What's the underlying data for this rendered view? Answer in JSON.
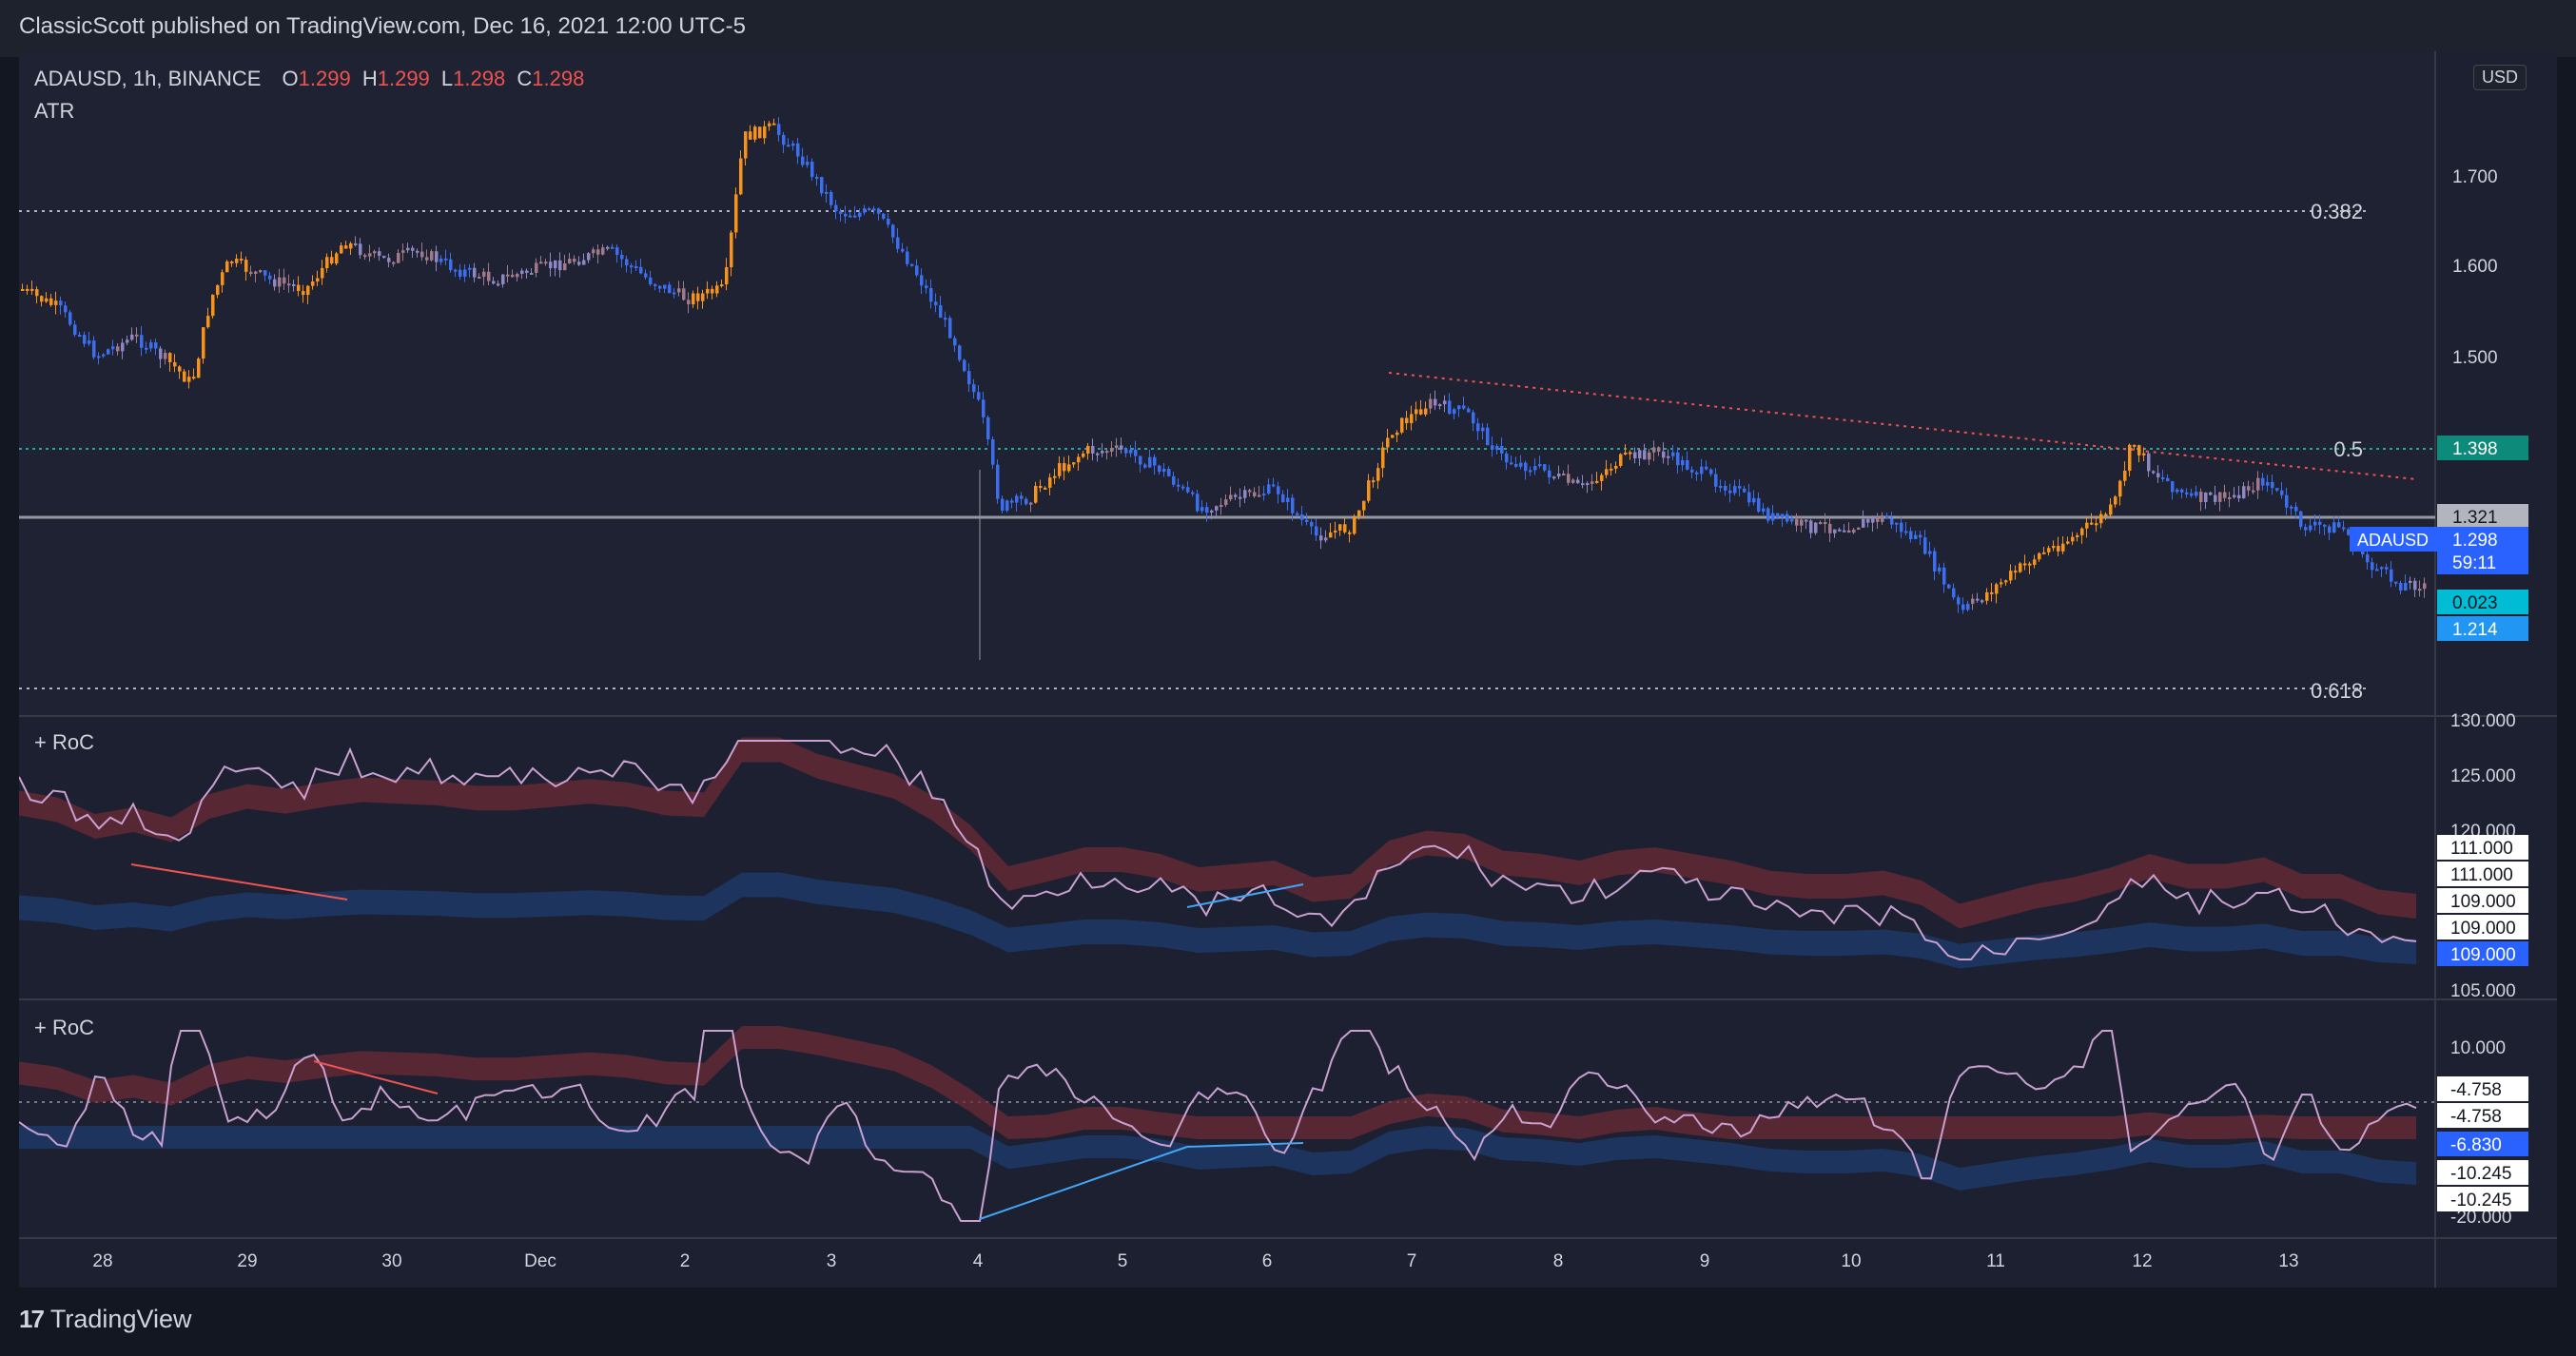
{
  "header": {
    "published": "ClassicScott published on TradingView.com, Dec 16, 2021 12:00 UTC-5"
  },
  "legend": {
    "symbol": "ADAUSD, 1h, BINANCE",
    "open_label": "O",
    "open": "1.299",
    "high_label": "H",
    "high": "1.299",
    "low_label": "L",
    "low": "1.298",
    "close_label": "C",
    "close": "1.298",
    "indicator": "ATR"
  },
  "currency_button": "USD",
  "panels": {
    "roc1_title": "+ RoC",
    "roc2_title": "+ RoC"
  },
  "price_axis": {
    "ticks": [
      "1.700",
      "1.600",
      "1.500"
    ],
    "fib_382": "0.382",
    "fib_5": "0.5",
    "fib_618": "0.618",
    "fib_5_value": "1.398",
    "level_value": "1.321",
    "symbol_tag": "ADAUSD",
    "last_price": "1.298",
    "countdown": "59:11",
    "atr_value": "0.023",
    "low_value": "1.214"
  },
  "roc1_axis": {
    "ticks": [
      "130.000",
      "125.000",
      "120.000",
      "105.000"
    ],
    "labels": [
      "111.000",
      "111.000",
      "109.000",
      "109.000",
      "109.000"
    ]
  },
  "roc2_axis": {
    "ticks": [
      "10.000",
      "-20.000"
    ],
    "labels": [
      "-4.758",
      "-4.758",
      "-6.830",
      "-10.245",
      "-10.245"
    ]
  },
  "time_axis": [
    "28",
    "29",
    "30",
    "Dec",
    "2",
    "3",
    "4",
    "5",
    "6",
    "7",
    "8",
    "9",
    "10",
    "11",
    "12",
    "13"
  ],
  "colors": {
    "background": "#131722",
    "pane": "#1c2030",
    "bull": "#f7931a",
    "bear": "#3b6ff0",
    "fib_green": "#26a69a",
    "trend_red": "#ef5350",
    "band_red": "#6b2a35",
    "band_blue": "#1e3a6b"
  },
  "footer": {
    "brand": "TradingView"
  }
}
